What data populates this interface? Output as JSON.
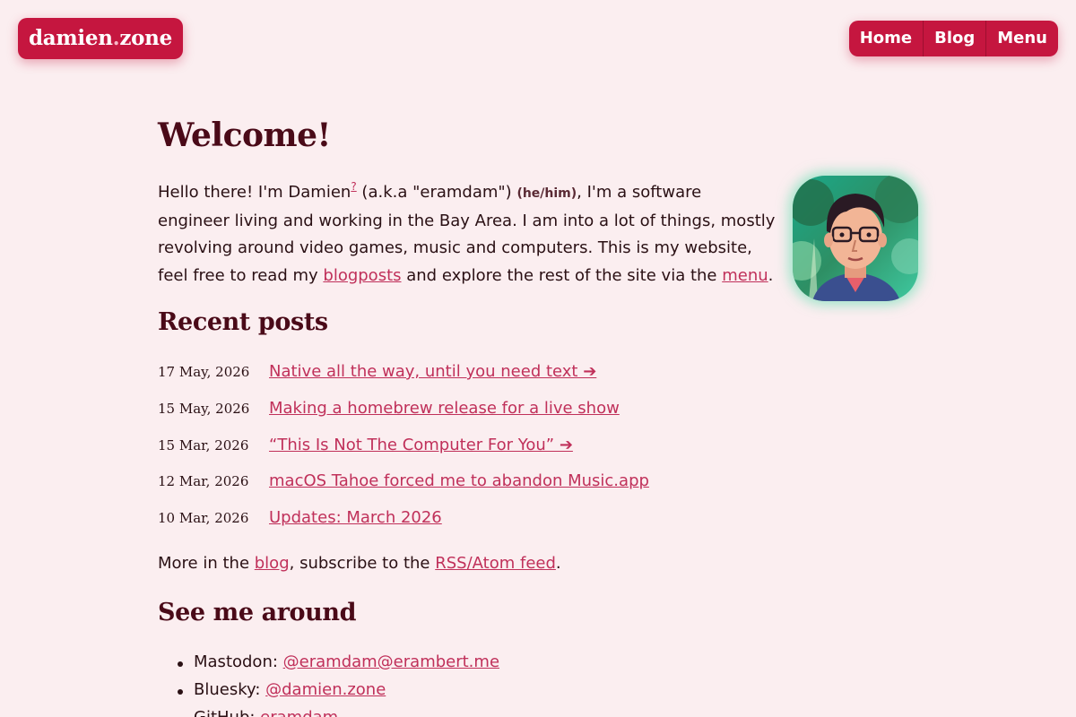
{
  "header": {
    "logo_main": "damien",
    "logo_dot": ".",
    "logo_tld": "zone",
    "nav": [
      "Home",
      "Blog",
      "Menu"
    ]
  },
  "main": {
    "title": "Welcome!",
    "intro": {
      "t1": "Hello there! I'm Damien",
      "sup": "?",
      "t2": " (a.k.a \"eramdam\") ",
      "pronouns": "(he/him)",
      "t3": ", I'm a software engineer living and working in the Bay Area. I am into a lot of things, mostly revolving around video games, music and computers. This is my website, feel free to read my ",
      "link_blogposts": "blogposts",
      "t4": " and explore the rest of the site via the ",
      "link_menu": "menu",
      "t5": "."
    },
    "recent_heading": "Recent posts",
    "posts": [
      {
        "date": "17 May, 2026",
        "title": "Native all the way, until you need text ➔"
      },
      {
        "date": "15 May, 2026",
        "title": "Making a homebrew release for a live show"
      },
      {
        "date": "15 Mar, 2026",
        "title": "“This Is Not The Computer For You” ➔"
      },
      {
        "date": "12 Mar, 2026",
        "title": "macOS Tahoe forced me to abandon Music.app"
      },
      {
        "date": "10 Mar, 2026",
        "title": "Updates: March 2026"
      }
    ],
    "more": {
      "t1": "More in the ",
      "link_blog": "blog",
      "t2": ", subscribe to the ",
      "link_rss": "RSS/Atom feed",
      "t3": "."
    },
    "socials_heading": "See me around",
    "socials": [
      {
        "label": "Mastodon: ",
        "link": "@eramdam@erambert.me"
      },
      {
        "label": "Bluesky: ",
        "link": "@damien.zone"
      },
      {
        "label": "GitHub: ",
        "link": "eramdam"
      }
    ]
  },
  "colors": {
    "accent": "#c5163f",
    "link": "#c0305a",
    "heading": "#4a0a18",
    "background": "#fbeef0"
  }
}
